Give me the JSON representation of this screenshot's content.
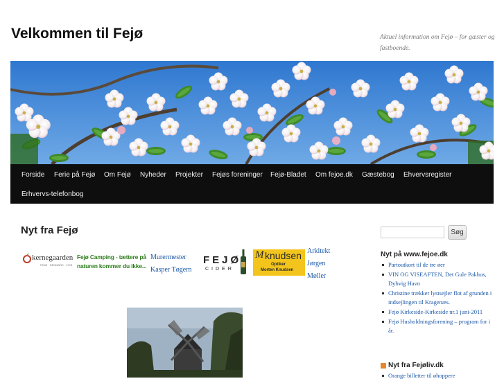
{
  "site": {
    "title": "Velkommen til Fejø",
    "description": "Aktuel information om Fejø – for gæster og fastboende."
  },
  "nav": {
    "items": [
      {
        "label": "Forside"
      },
      {
        "label": "Ferie på Fejø"
      },
      {
        "label": "Om Fejø"
      },
      {
        "label": "Nyheder"
      },
      {
        "label": "Projekter"
      },
      {
        "label": "Fejøs foreninger"
      },
      {
        "label": "Fejø-Bladet"
      },
      {
        "label": "Om fejoe.dk"
      },
      {
        "label": "Gæstebog"
      },
      {
        "label": "Ehvervsregister"
      },
      {
        "label": "Erhvervs-telefonbog"
      }
    ]
  },
  "content": {
    "heading": "Nyt fra Fejø",
    "sponsors": {
      "kernegaarden": {
        "name": "kernegaarden",
        "tagline": "FEJØ · DENMARK · 1978"
      },
      "camping": {
        "line1": "Fejø Camping - tættere på",
        "line2": "naturen kommer du ikke..."
      },
      "murermester": [
        "Murermester",
        "Kasper Tøgern"
      ],
      "cider": {
        "top": "FEJØ",
        "bottom": "CIDER"
      },
      "knudsen": {
        "name": "knudsen",
        "line1": "Optiker",
        "line2": "Morten Knudsen"
      },
      "arkitekt": [
        "Arkitekt",
        "Jørgen",
        "Møller"
      ]
    }
  },
  "sidebar": {
    "search": {
      "placeholder": "",
      "button_label": "Søg"
    },
    "widget1": {
      "title": "Nyt på www.fejoe.dk",
      "items": [
        "Partoutkort til de tre øer",
        "VIN OG VISEAFTEN, Det Gule Pakhus, Dybvig Havn",
        "Christine trækker lystsejler flot af grunden i indsejlingen til Kragenæs.",
        "Fejø Kirkeside-Kirkeside nr.1 juni-2011",
        "Fejø Husholdningsforening – program for i år."
      ]
    },
    "widget2": {
      "title": "Nyt fra Fejøliv.dk",
      "items": [
        "Orange billetter til øhoppere"
      ]
    }
  },
  "colors": {
    "nav_bg": "#0e0e0e",
    "link": "#1a57a8",
    "sky": "#3d86d6",
    "rss": "#e8862a",
    "camping_green": "#2f7d1e"
  }
}
